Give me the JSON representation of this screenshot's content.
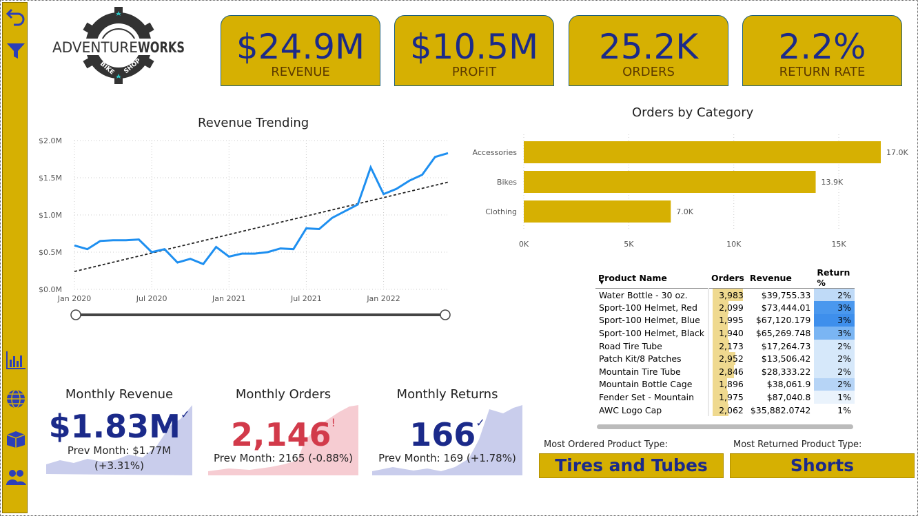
{
  "logo": {
    "brand_light": "ADVENTURE",
    "brand_bold": "WORKS",
    "ring_left": "BIKE",
    "ring_right": "SHOP"
  },
  "sidebar": {
    "icons": [
      "back-arrow-icon",
      "filter-icon",
      "bar-chart-icon",
      "globe-icon",
      "box-icon",
      "people-icon"
    ]
  },
  "kpis": [
    {
      "value": "$24.9M",
      "label": "REVENUE"
    },
    {
      "value": "$10.5M",
      "label": "PROFIT"
    },
    {
      "value": "25.2K",
      "label": "ORDERS"
    },
    {
      "value": "2.2%",
      "label": "RETURN RATE"
    }
  ],
  "chart_data": [
    {
      "type": "line",
      "title": "Revenue Trending",
      "x_ticks": [
        "Jan 2020",
        "Jul 2020",
        "Jan 2021",
        "Jul 2021",
        "Jan 2022"
      ],
      "y_ticks": [
        "$0.0M",
        "$0.5M",
        "$1.0M",
        "$1.5M",
        "$2.0M"
      ],
      "ylim": [
        0,
        2.0
      ],
      "y_unit": "$M",
      "x": [
        "2020-01",
        "2020-02",
        "2020-03",
        "2020-04",
        "2020-05",
        "2020-06",
        "2020-07",
        "2020-08",
        "2020-09",
        "2020-10",
        "2020-11",
        "2020-12",
        "2021-01",
        "2021-02",
        "2021-03",
        "2021-04",
        "2021-05",
        "2021-06",
        "2021-07",
        "2021-08",
        "2021-09",
        "2021-10",
        "2021-11",
        "2021-12",
        "2022-01",
        "2022-02",
        "2022-03",
        "2022-04",
        "2022-05",
        "2022-06"
      ],
      "series": [
        {
          "values": [
            0.59,
            0.54,
            0.65,
            0.66,
            0.66,
            0.67,
            0.5,
            0.54,
            0.36,
            0.41,
            0.34,
            0.57,
            0.44,
            0.48,
            0.48,
            0.5,
            0.55,
            0.54,
            0.82,
            0.81,
            0.96,
            1.05,
            1.14,
            1.64,
            1.28,
            1.35,
            1.46,
            1.54,
            1.78,
            1.83
          ]
        }
      ],
      "trendline": [
        0.24,
        1.44
      ],
      "line_color": "#1e8ff0",
      "grid": true
    },
    {
      "type": "bar",
      "orientation": "horizontal",
      "title": "Orders by Category",
      "categories": [
        "Accessories",
        "Bikes",
        "Clothing"
      ],
      "values": [
        17000,
        13900,
        7000
      ],
      "data_labels": [
        "17.0K",
        "13.9K",
        "7.0K"
      ],
      "x_ticks": [
        "0K",
        "5K",
        "10K",
        "15K"
      ],
      "xlim": [
        0,
        17000
      ],
      "bar_color": "#d6b002"
    }
  ],
  "table": {
    "headers": [
      "Product Name",
      "Orders",
      "Revenue",
      "Return %"
    ],
    "rows": [
      {
        "name": "Water Bottle - 30 oz.",
        "orders": "3,983",
        "revenue": "$39,755.33",
        "ret": "2%",
        "ord_frac": 1.0,
        "ret_color": "#bfdaf7"
      },
      {
        "name": "Sport-100 Helmet, Red",
        "orders": "2,099",
        "revenue": "$73,444.01",
        "ret": "3%",
        "ord_frac": 0.53,
        "ret_color": "#4a98ee"
      },
      {
        "name": "Sport-100 Helmet, Blue",
        "orders": "1,995",
        "revenue": "$67,120.179",
        "ret": "3%",
        "ord_frac": 0.5,
        "ret_color": "#3e8fec"
      },
      {
        "name": "Sport-100 Helmet, Black",
        "orders": "1,940",
        "revenue": "$65,269.748",
        "ret": "3%",
        "ord_frac": 0.49,
        "ret_color": "#7ab5f3"
      },
      {
        "name": "Road Tire Tube",
        "orders": "2,173",
        "revenue": "$17,264.73",
        "ret": "2%",
        "ord_frac": 0.55,
        "ret_color": "#d6e8fa"
      },
      {
        "name": "Patch Kit/8 Patches",
        "orders": "2,952",
        "revenue": "$13,506.42",
        "ret": "2%",
        "ord_frac": 0.74,
        "ret_color": "#d6e8fa"
      },
      {
        "name": "Mountain Tire Tube",
        "orders": "2,846",
        "revenue": "$28,333.22",
        "ret": "2%",
        "ord_frac": 0.71,
        "ret_color": "#d6e8fa"
      },
      {
        "name": "Mountain Bottle Cage",
        "orders": "1,896",
        "revenue": "$38,061.9",
        "ret": "2%",
        "ord_frac": 0.48,
        "ret_color": "#b6d4f6"
      },
      {
        "name": "Fender Set - Mountain",
        "orders": "1,975",
        "revenue": "$87,040.8",
        "ret": "1%",
        "ord_frac": 0.5,
        "ret_color": "#eaf3fc"
      },
      {
        "name": "AWC Logo Cap",
        "orders": "2,062",
        "revenue": "$35,882.0742",
        "ret": "1%",
        "ord_frac": 0.52,
        "ret_color": "#ffffff"
      }
    ]
  },
  "monthly": [
    {
      "title": "Monthly Revenue",
      "value": "$1.83M",
      "prev_line1": "Prev Month: $1.77M",
      "prev_line2": "(+3.31%)",
      "color": "#1b2a8a",
      "fill": "#c9cdec",
      "indicator": "✓"
    },
    {
      "title": "Monthly Orders",
      "value": "2,146",
      "prev_line1": "Prev Month: 2165 (-0.88%)",
      "prev_line2": "",
      "color": "#d23a4a",
      "fill": "#f6ccd2",
      "indicator": "!"
    },
    {
      "title": "Monthly Returns",
      "value": "166",
      "prev_line1": "Prev Month: 169 (+1.78%)",
      "prev_line2": "",
      "color": "#1b2a8a",
      "fill": "#c9cdec",
      "indicator": "✓"
    }
  ],
  "product_types": {
    "ordered_label": "Most Ordered Product Type:",
    "ordered_value": "Tires and Tubes",
    "returned_label": "Most Returned Product Type:",
    "returned_value": "Shorts"
  }
}
